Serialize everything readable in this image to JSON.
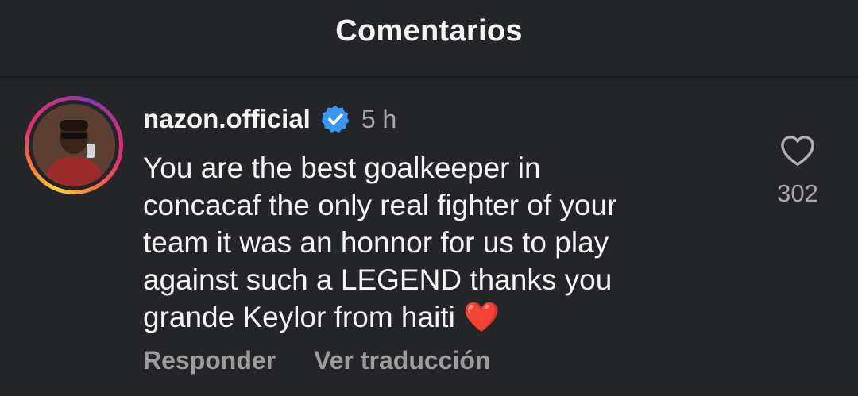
{
  "header": {
    "title": "Comentarios"
  },
  "comment": {
    "username": "nazon.official",
    "verified_icon": "verified-badge-icon",
    "time": "5 h",
    "text": "You are the best goalkeeper in\nconcacaf the only real fighter of your\nteam it was an honnor for us to play\nagainst such a LEGEND thanks you\ngrande Keylor from haiti ❤️",
    "like_icon": "heart-outline-icon",
    "like_count": "302",
    "actions": {
      "reply": "Responder",
      "translate": "Ver traducción"
    }
  },
  "colors": {
    "background": "#242528",
    "text_primary": "#f5f5f5",
    "text_secondary": "#a8a8a8",
    "verified_blue": "#3897f0"
  }
}
